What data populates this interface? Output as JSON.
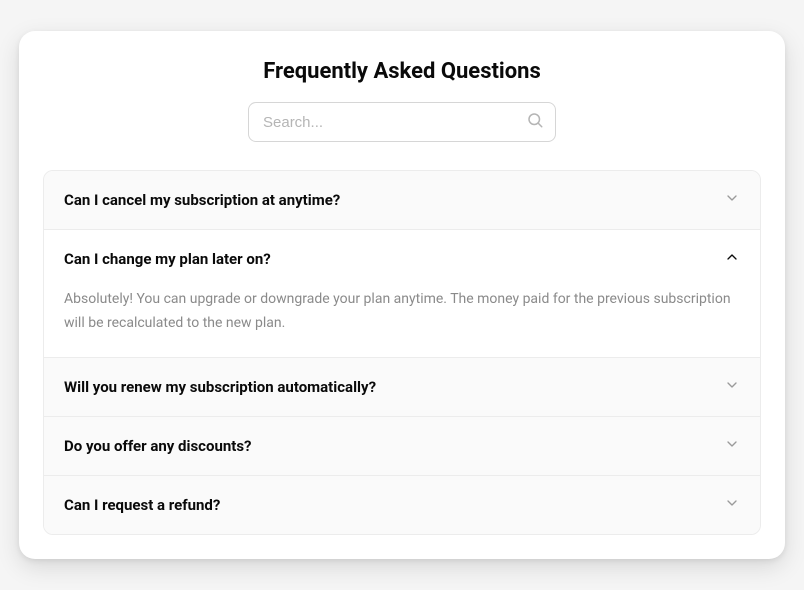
{
  "title": "Frequently Asked Questions",
  "search": {
    "placeholder": "Search..."
  },
  "faq": [
    {
      "question": "Can I cancel my subscription at anytime?",
      "answer": "",
      "expanded": false
    },
    {
      "question": "Can I change my plan later on?",
      "answer": "Absolutely! You can upgrade or downgrade your plan anytime. The money paid for the previous subscription will be recalculated to the new plan.",
      "expanded": true
    },
    {
      "question": "Will you renew my subscription automatically?",
      "answer": "",
      "expanded": false
    },
    {
      "question": "Do you offer any discounts?",
      "answer": "",
      "expanded": false
    },
    {
      "question": "Can I request a refund?",
      "answer": "",
      "expanded": false
    }
  ]
}
